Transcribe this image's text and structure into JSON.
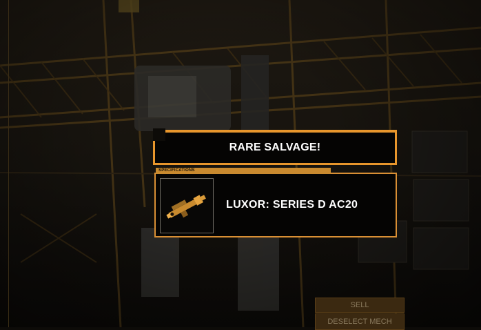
{
  "popup": {
    "title": "RARE SALVAGE!",
    "specifications_label": "SPECIFICATIONS",
    "item_name": "LUXOR: SERIES D AC20",
    "item_icon": "autocannon-icon"
  },
  "buttons": {
    "sell": "SELL",
    "deselect_mech": "DESELECT MECH"
  },
  "colors": {
    "accent": "#e8962c",
    "panel_bg": "#050403",
    "text": "#ffffff"
  }
}
